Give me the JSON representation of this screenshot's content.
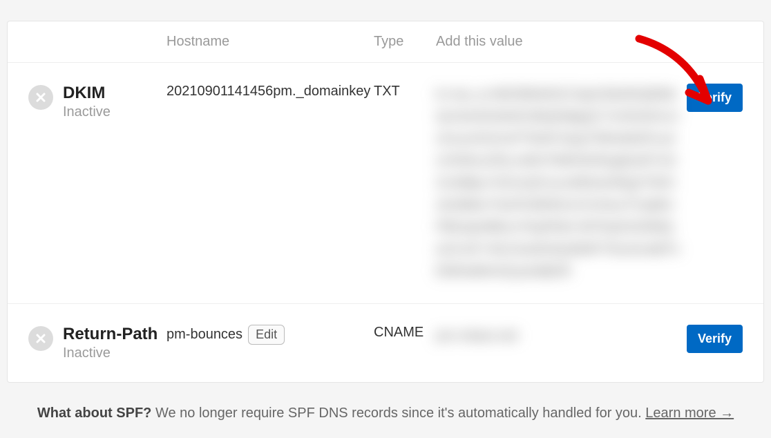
{
  "headers": {
    "hostname": "Hostname",
    "type": "Type",
    "value": "Add this value"
  },
  "records": [
    {
      "name": "DKIM",
      "status": "Inactive",
      "hostname": "20210901141456pm._domainkey",
      "type": "TXT",
      "value_masked": "k=rsa; p=MIGfMA0GCSqGSIb3DQEBAQUAA4GNADCBiQKBgQC7nX0vNUUJm/coUGGXvP7bHKYeqoTMHstb3Fxu4nVh5hsJZ5Lm0hI7NiRHK9Gg9ssR7cDZx3d8pJ+EGcQG1urzMDwG8QpT3hOz0x9b6cY5uF0JMShUUVUhsuTXxjMUPBtJqoN8KyYHiyRHb+Nl7NoK0JDMQe2rUxF+hKcGwIDAQAB4F7EsrtxnddTxEMHe8hH32yshdB2R",
      "editable": false,
      "verify_label": "Verify",
      "highlight": true
    },
    {
      "name": "Return-Path",
      "status": "Inactive",
      "hostname": "pm-bounces",
      "type": "CNAME",
      "value_masked": "pm.mtasv.net",
      "editable": true,
      "edit_label": "Edit",
      "verify_label": "Verify",
      "highlight": false
    }
  ],
  "spf": {
    "heading": "What about SPF?",
    "body": "We no longer require SPF DNS records since it's automatically handled for you.",
    "link": "Learn more →"
  }
}
